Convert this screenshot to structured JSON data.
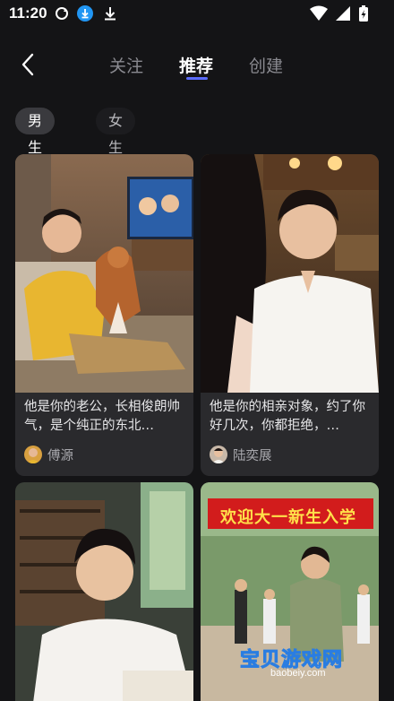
{
  "status_bar": {
    "time": "11:20",
    "icons": [
      "sync-icon",
      "download-badge-icon",
      "download-icon"
    ],
    "right_icons": [
      "wifi-icon",
      "signal-icon",
      "battery-charging-icon"
    ]
  },
  "header": {
    "tabs": [
      {
        "label": "关注",
        "active": false
      },
      {
        "label": "推荐",
        "active": true
      },
      {
        "label": "创建",
        "active": false
      }
    ],
    "accent_color": "#5b6cff"
  },
  "filters": [
    {
      "label": "男生",
      "active": true
    },
    {
      "label": "女生",
      "active": false
    }
  ],
  "cards": [
    {
      "description": "他是你的老公，长相俊朗帅气，是个纯正的东北…",
      "author": "傅源"
    },
    {
      "description": "他是你的相亲对象，约了你好几次，你都拒绝，…",
      "author": "陆奕展"
    },
    {
      "description": "",
      "author": ""
    },
    {
      "description": "",
      "author": "",
      "banner_text": "欢迎大一新生入学"
    }
  ],
  "watermark": {
    "text": "宝贝游戏网",
    "url": "baobeiy.com"
  }
}
